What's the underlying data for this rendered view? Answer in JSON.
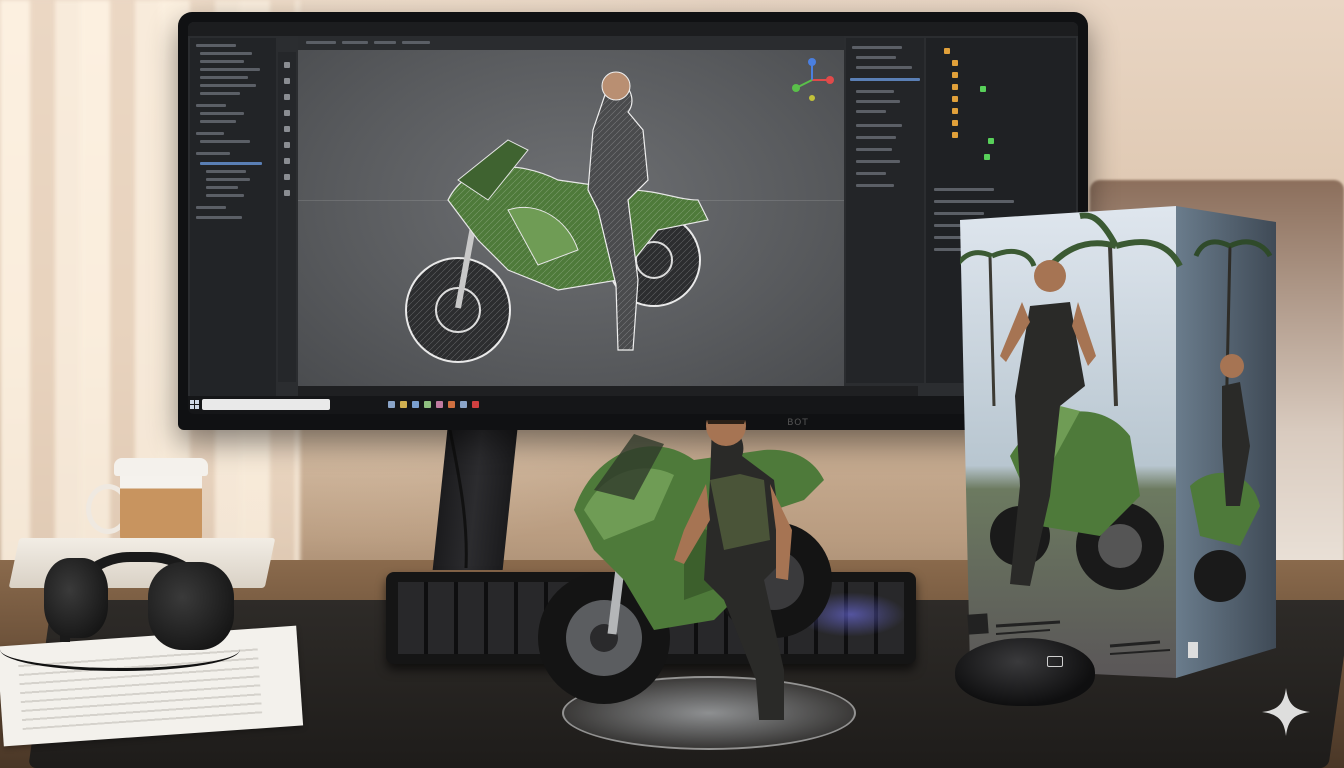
{
  "image": {
    "monitor_brand": "BOT",
    "colors": {
      "bike_green": "#4e7a3a",
      "bike_green_light": "#6f9c55",
      "screen_bg": "#2b2d30",
      "viewport_bg": "#5e6063",
      "wall": "#e3cdb7",
      "desk_wood": "#6e533b",
      "mat": "#252321",
      "cup_sleeve": "#c8945f",
      "ui_highlight": "#5a7fb5"
    },
    "icons": [
      "axis-gizmo-icon",
      "windows-start-icon",
      "sparkle-icon",
      "mouse-logo-icon"
    ]
  }
}
